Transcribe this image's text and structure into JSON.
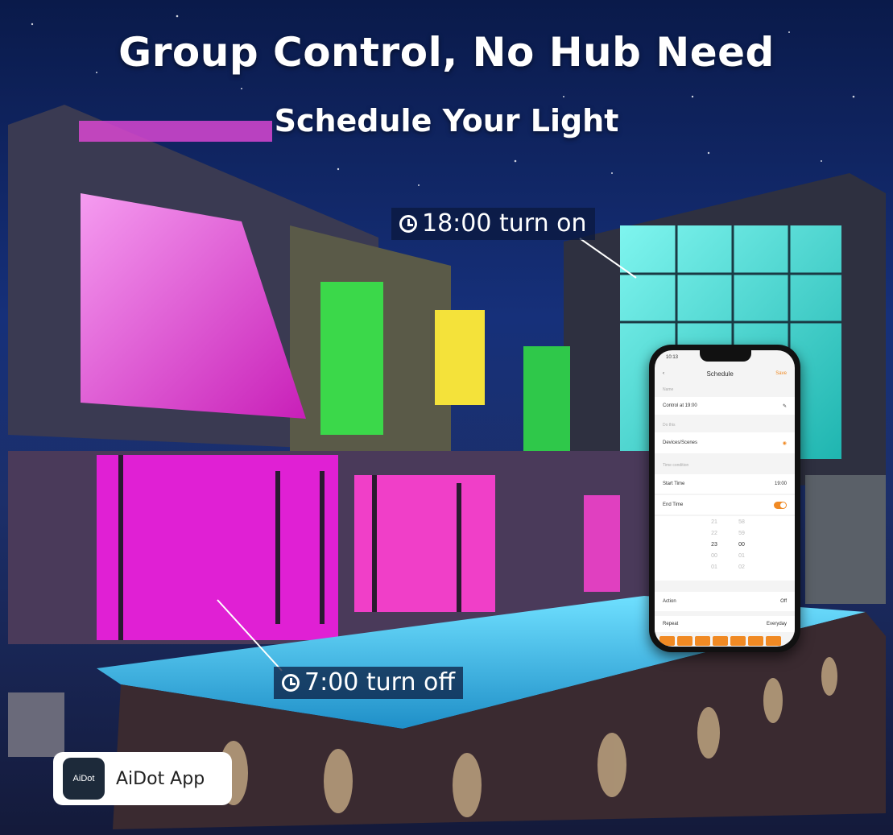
{
  "headline": "Group Control, No Hub Need",
  "subheadline": "Schedule Your Light",
  "callouts": {
    "on": "18:00 turn on",
    "off": "7:00 turn off"
  },
  "phone": {
    "time": "10:13",
    "title": "Schedule",
    "save": "Save",
    "name_section": "Name",
    "name_value": "Control at 19:00",
    "do_this_section": "Do this",
    "devices_label": "Devices/Scenes",
    "time_condition_section": "Time condition",
    "start_time_label": "Start Time",
    "start_time_value": "19:00",
    "end_time_label": "End Time",
    "picker_hours": [
      "21",
      "22",
      "23",
      "00",
      "01"
    ],
    "picker_minutes": [
      "58",
      "59",
      "00",
      "01",
      "02"
    ],
    "action_label": "Action",
    "action_value": "Off",
    "repeat_label": "Repeat",
    "repeat_value": "Everyday"
  },
  "app": {
    "logo_text": "AiDot",
    "name": "AiDot App"
  },
  "colors": {
    "accent": "#f08a24",
    "pink_light": "#e23bd6",
    "green_light": "#3bd84a",
    "teal_light": "#2fd6c8",
    "pool": "#45c8ef"
  }
}
